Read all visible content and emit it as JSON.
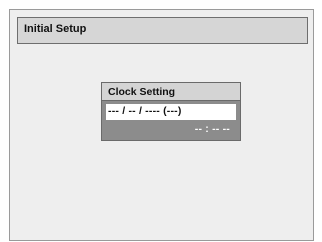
{
  "screen": {
    "title": "Initial Setup"
  },
  "dialog": {
    "title": "Clock Setting",
    "date_value": "--- / -- / ---- (---)",
    "time_value": "-- : -- --"
  },
  "colors": {
    "screen_background": "#eeeeee",
    "title_bar": "#d6d6d6",
    "dialog_body": "#8c8c8c",
    "dialog_header": "#d4d4d4",
    "selected_field": "#ffffff"
  }
}
